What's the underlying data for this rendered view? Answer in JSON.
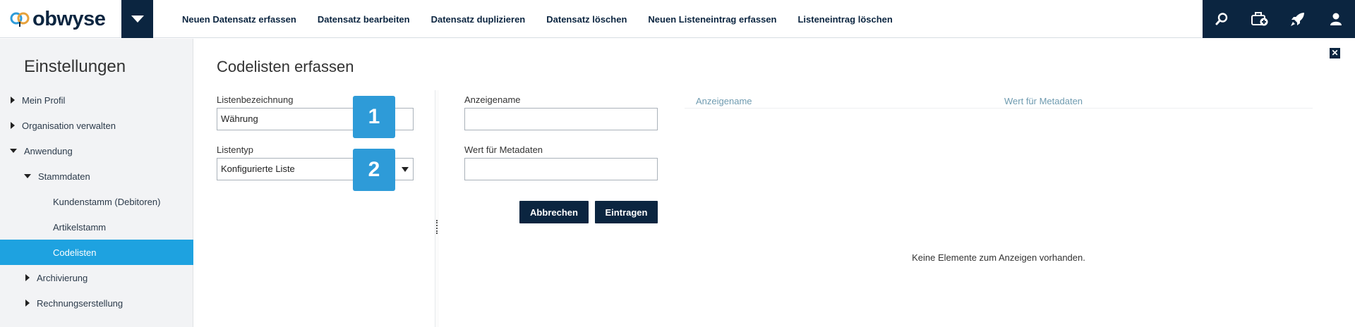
{
  "app": {
    "logo_text": "obwyse"
  },
  "nav": {
    "items": [
      "Neuen Datensatz erfassen",
      "Datensatz bearbeiten",
      "Datensatz duplizieren",
      "Datensatz löschen",
      "Neuen Listeneintrag erfassen",
      "Listeneintrag löschen"
    ]
  },
  "tools": [
    "search-icon",
    "add-case-icon",
    "rocket-icon",
    "user-icon"
  ],
  "sidebar": {
    "title": "Einstellungen",
    "items": [
      {
        "label": "Mein Profil"
      },
      {
        "label": "Organisation verwalten"
      },
      {
        "label": "Anwendung"
      },
      {
        "label": "Stammdaten"
      },
      {
        "label": "Kundenstamm (Debitoren)"
      },
      {
        "label": "Artikelstamm"
      },
      {
        "label": "Codelisten"
      },
      {
        "label": "Archivierung"
      },
      {
        "label": "Rechnungserstellung"
      }
    ]
  },
  "main": {
    "title": "Codelisten erfassen",
    "close_label": "✕",
    "list_name_label": "Listenbezeichnung",
    "list_name_value": "Währung",
    "list_type_label": "Listentyp",
    "list_type_value": "Konfigurierte Liste",
    "badge_1": "1",
    "badge_2": "2",
    "display_name_label": "Anzeigename",
    "display_name_value": "",
    "metadata_value_label": "Wert für Metadaten",
    "metadata_value_value": "",
    "cancel_label": "Abbrechen",
    "submit_label": "Eintragen",
    "grid": {
      "columns": [
        "Anzeigename",
        "Wert für Metadaten"
      ],
      "empty_message": "Keine Elemente zum Anzeigen vorhanden."
    }
  },
  "colors": {
    "navy": "#0b2540",
    "accent": "#1ea2e0",
    "badge": "#2e9bd8"
  }
}
